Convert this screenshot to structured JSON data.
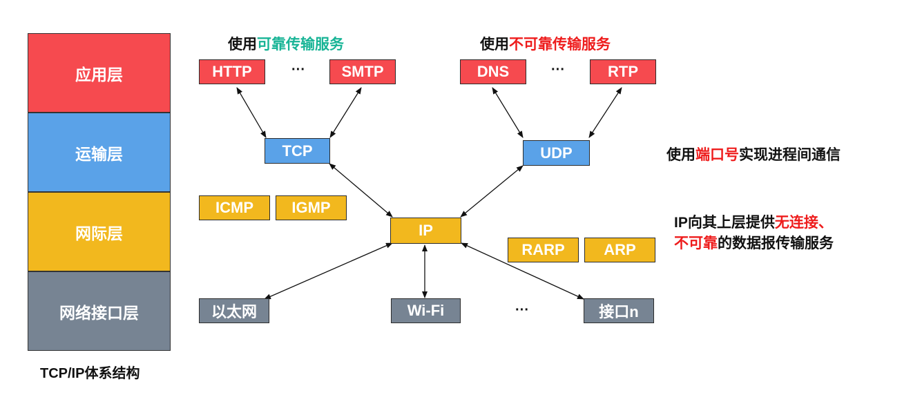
{
  "layers": [
    {
      "label": "应用层",
      "color": "#f64a4f"
    },
    {
      "label": "运输层",
      "color": "#5aa2e8"
    },
    {
      "label": "网际层",
      "color": "#f2b81e"
    },
    {
      "label": "网络接口层",
      "color": "#778493"
    }
  ],
  "caption": "TCP/IP体系结构",
  "app": {
    "left_heading": {
      "prefix": "使用",
      "highlight": "可靠传输服务"
    },
    "right_heading": {
      "prefix": "使用",
      "highlight": "不可靠传输服务"
    },
    "http": "HTTP",
    "smtp": "SMTP",
    "dns": "DNS",
    "rtp": "RTP",
    "dots_left": "···",
    "dots_right": "···"
  },
  "transport": {
    "tcp": "TCP",
    "udp": "UDP"
  },
  "internet": {
    "icmp": "ICMP",
    "igmp": "IGMP",
    "ip": "IP",
    "rarp": "RARP",
    "arp": "ARP"
  },
  "link": {
    "ethernet": "以太网",
    "wifi": "Wi-Fi",
    "dots": "···",
    "iface": "接口n"
  },
  "notes": {
    "port": {
      "prefix": "使用",
      "highlight": "端口号",
      "suffix": "实现进程间通信"
    },
    "ip_line1": {
      "prefix": "IP向其上层提供",
      "highlight": "无连接、"
    },
    "ip_line2": {
      "highlight": "不可靠",
      "suffix": "的数据报传输服务"
    }
  },
  "colors": {
    "red": "#f64a4f",
    "blue": "#5aa2e8",
    "yellow": "#f2b81e",
    "gray": "#778493",
    "green": "#18b496",
    "highlight_red": "#ee1c1c"
  }
}
